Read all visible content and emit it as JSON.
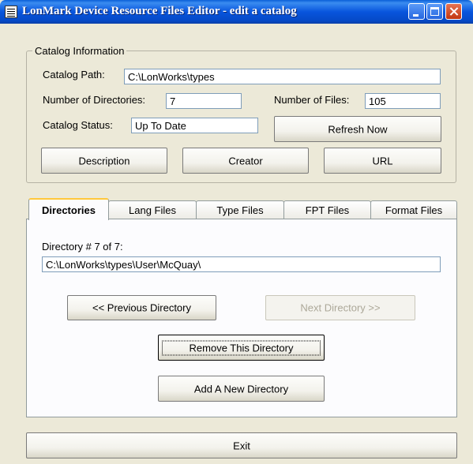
{
  "window": {
    "title": "LonMark Device Resource Files Editor - edit a catalog",
    "app_icon": "document-list-icon"
  },
  "catalog": {
    "legend": "Catalog Information",
    "path_label": "Catalog Path:",
    "path_value": "C:\\LonWorks\\types",
    "num_dirs_label": "Number of Directories:",
    "num_dirs_value": "7",
    "num_files_label": "Number of Files:",
    "num_files_value": "105",
    "status_label": "Catalog Status:",
    "status_value": "Up To Date",
    "refresh_button": "Refresh Now",
    "description_button": "Description",
    "creator_button": "Creator",
    "url_button": "URL"
  },
  "tabs": [
    "Directories",
    "Lang Files",
    "Type Files",
    "FPT Files",
    "Format Files"
  ],
  "directories": {
    "counter_label": "Directory # 7 of 7:",
    "path_value": "C:\\LonWorks\\types\\User\\McQuay\\",
    "prev_button": "<< Previous Directory",
    "next_button": "Next Directory >>",
    "remove_button": "Remove This Directory",
    "add_button": "Add A New Directory"
  },
  "exit_button": "Exit"
}
